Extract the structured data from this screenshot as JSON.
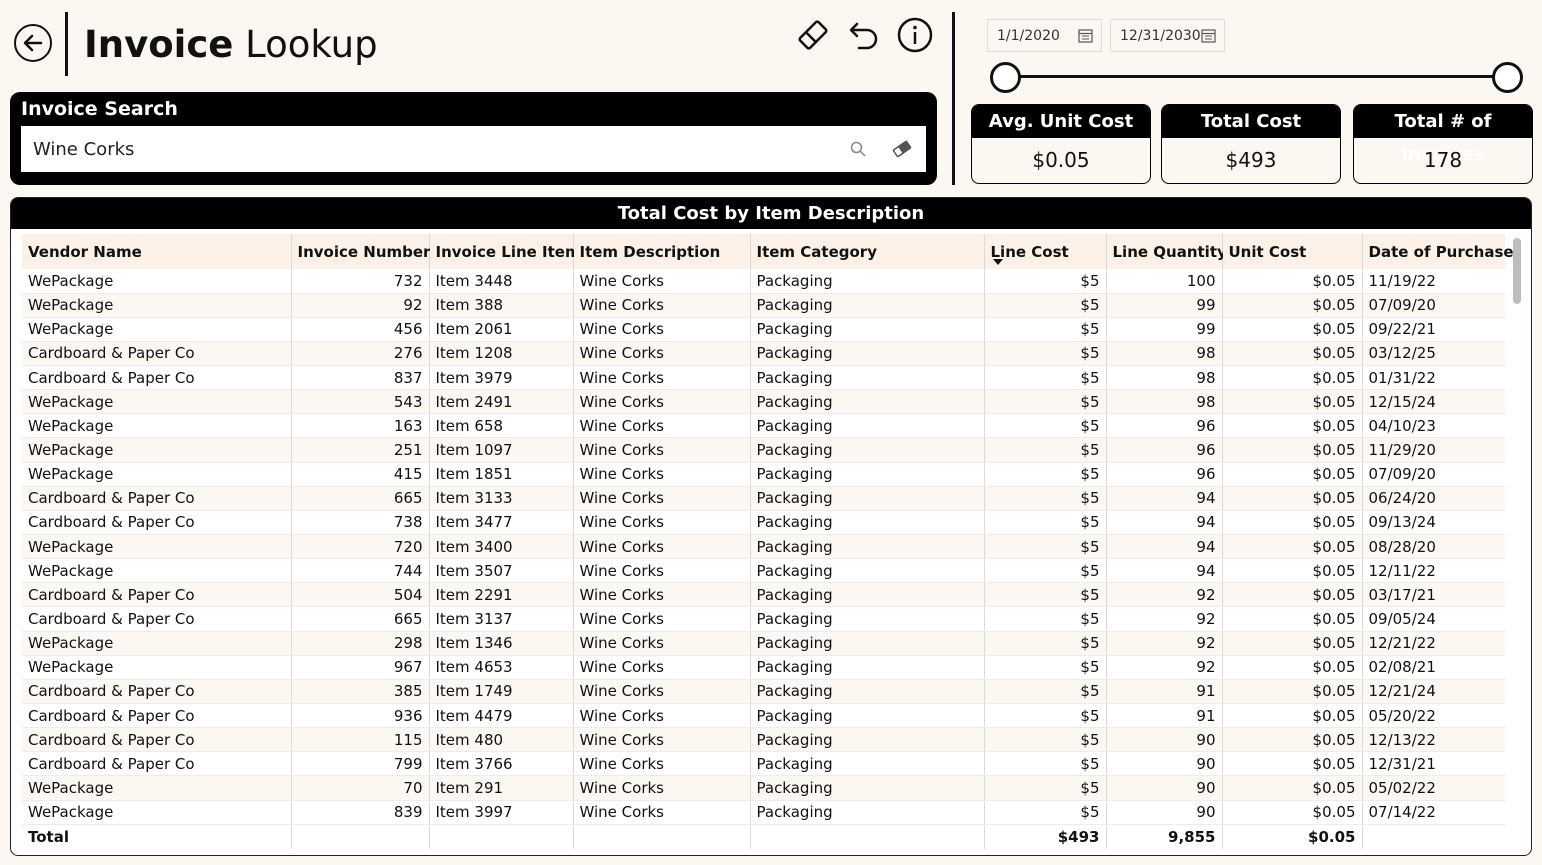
{
  "header": {
    "title_bold": "Invoice",
    "title_light": "Lookup"
  },
  "search": {
    "title": "Invoice Search",
    "value": "Wine Corks"
  },
  "date_range": {
    "start": "1/1/2020",
    "end": "12/31/2030"
  },
  "kpis": [
    {
      "label": "Avg. Unit Cost",
      "value": "$0.05"
    },
    {
      "label": "Total Cost",
      "value": "$493"
    },
    {
      "label": "Total # of Invoices",
      "value": "178"
    }
  ],
  "table": {
    "title": "Total Cost by Item Description",
    "columns": [
      "Vendor Name",
      "Invoice Number",
      "Invoice Line Item",
      "Item Description",
      "Item Category",
      "Line Cost",
      "Line Quantity",
      "Unit Cost",
      "Date of Purchase"
    ],
    "sorted_column": "Line Cost",
    "rows": [
      [
        "WePackage",
        "732",
        "Item 3448",
        "Wine Corks",
        "Packaging",
        "$5",
        "100",
        "$0.05",
        "11/19/22"
      ],
      [
        "WePackage",
        "92",
        "Item 388",
        "Wine Corks",
        "Packaging",
        "$5",
        "99",
        "$0.05",
        "07/09/20"
      ],
      [
        "WePackage",
        "456",
        "Item 2061",
        "Wine Corks",
        "Packaging",
        "$5",
        "99",
        "$0.05",
        "09/22/21"
      ],
      [
        "Cardboard & Paper Co",
        "276",
        "Item 1208",
        "Wine Corks",
        "Packaging",
        "$5",
        "98",
        "$0.05",
        "03/12/25"
      ],
      [
        "Cardboard & Paper Co",
        "837",
        "Item 3979",
        "Wine Corks",
        "Packaging",
        "$5",
        "98",
        "$0.05",
        "01/31/22"
      ],
      [
        "WePackage",
        "543",
        "Item 2491",
        "Wine Corks",
        "Packaging",
        "$5",
        "98",
        "$0.05",
        "12/15/24"
      ],
      [
        "WePackage",
        "163",
        "Item 658",
        "Wine Corks",
        "Packaging",
        "$5",
        "96",
        "$0.05",
        "04/10/23"
      ],
      [
        "WePackage",
        "251",
        "Item 1097",
        "Wine Corks",
        "Packaging",
        "$5",
        "96",
        "$0.05",
        "11/29/20"
      ],
      [
        "WePackage",
        "415",
        "Item 1851",
        "Wine Corks",
        "Packaging",
        "$5",
        "96",
        "$0.05",
        "07/09/20"
      ],
      [
        "Cardboard & Paper Co",
        "665",
        "Item 3133",
        "Wine Corks",
        "Packaging",
        "$5",
        "94",
        "$0.05",
        "06/24/20"
      ],
      [
        "Cardboard & Paper Co",
        "738",
        "Item 3477",
        "Wine Corks",
        "Packaging",
        "$5",
        "94",
        "$0.05",
        "09/13/24"
      ],
      [
        "WePackage",
        "720",
        "Item 3400",
        "Wine Corks",
        "Packaging",
        "$5",
        "94",
        "$0.05",
        "08/28/20"
      ],
      [
        "WePackage",
        "744",
        "Item 3507",
        "Wine Corks",
        "Packaging",
        "$5",
        "94",
        "$0.05",
        "12/11/22"
      ],
      [
        "Cardboard & Paper Co",
        "504",
        "Item 2291",
        "Wine Corks",
        "Packaging",
        "$5",
        "92",
        "$0.05",
        "03/17/21"
      ],
      [
        "Cardboard & Paper Co",
        "665",
        "Item 3137",
        "Wine Corks",
        "Packaging",
        "$5",
        "92",
        "$0.05",
        "09/05/24"
      ],
      [
        "WePackage",
        "298",
        "Item 1346",
        "Wine Corks",
        "Packaging",
        "$5",
        "92",
        "$0.05",
        "12/21/22"
      ],
      [
        "WePackage",
        "967",
        "Item 4653",
        "Wine Corks",
        "Packaging",
        "$5",
        "92",
        "$0.05",
        "02/08/21"
      ],
      [
        "Cardboard & Paper Co",
        "385",
        "Item 1749",
        "Wine Corks",
        "Packaging",
        "$5",
        "91",
        "$0.05",
        "12/21/24"
      ],
      [
        "Cardboard & Paper Co",
        "936",
        "Item 4479",
        "Wine Corks",
        "Packaging",
        "$5",
        "91",
        "$0.05",
        "05/20/22"
      ],
      [
        "Cardboard & Paper Co",
        "115",
        "Item 480",
        "Wine Corks",
        "Packaging",
        "$5",
        "90",
        "$0.05",
        "12/13/22"
      ],
      [
        "Cardboard & Paper Co",
        "799",
        "Item 3766",
        "Wine Corks",
        "Packaging",
        "$5",
        "90",
        "$0.05",
        "12/31/21"
      ],
      [
        "WePackage",
        "70",
        "Item 291",
        "Wine Corks",
        "Packaging",
        "$5",
        "90",
        "$0.05",
        "05/02/22"
      ],
      [
        "WePackage",
        "839",
        "Item 3997",
        "Wine Corks",
        "Packaging",
        "$5",
        "90",
        "$0.05",
        "07/14/22"
      ]
    ],
    "totals": {
      "label": "Total",
      "line_cost": "$493",
      "line_quantity": "9,855",
      "unit_cost": "$0.05"
    }
  },
  "colors": {
    "background": "#fdf7f2",
    "header_band": "#fdf0e6",
    "dark": "#000000"
  }
}
